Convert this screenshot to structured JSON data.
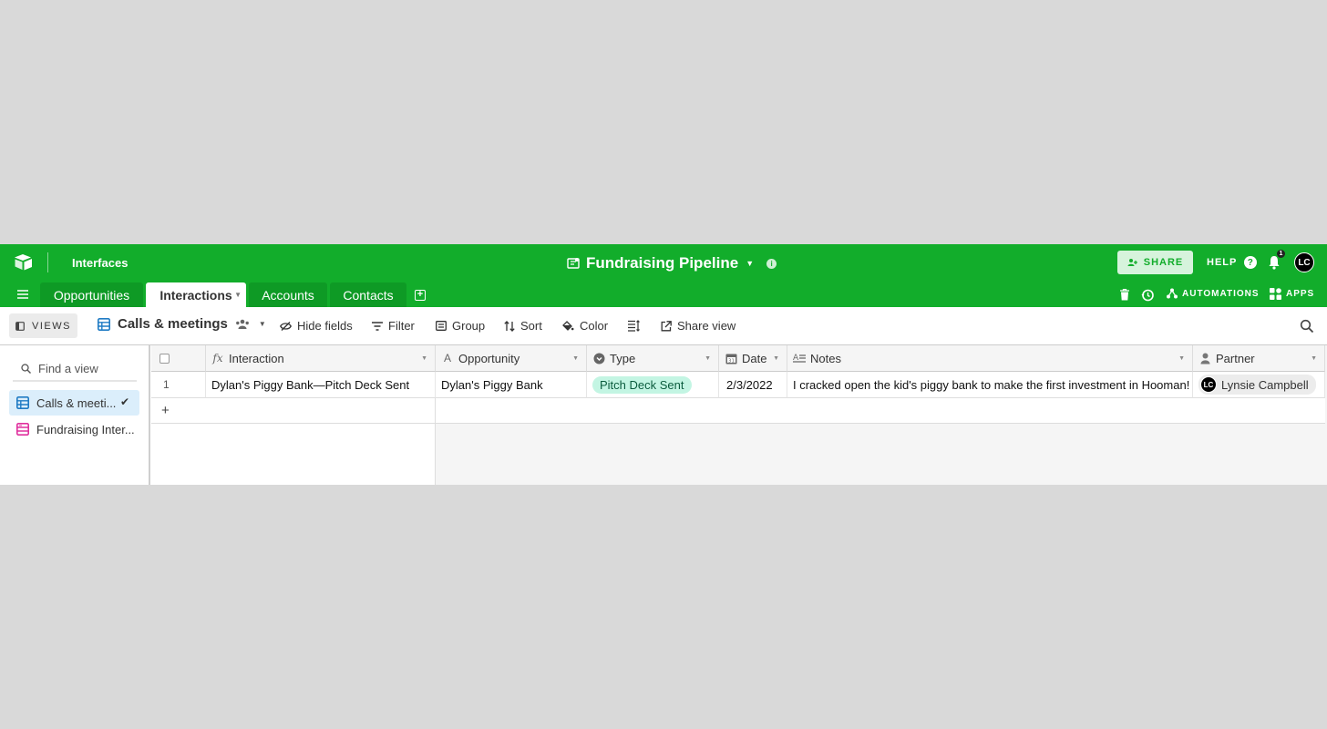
{
  "header": {
    "interfaces_label": "Interfaces",
    "base_name": "Fundraising Pipeline",
    "share_label": "SHARE",
    "help_label": "HELP",
    "notification_count": "1",
    "user_initials": "LC"
  },
  "tabs": [
    {
      "label": "Opportunities"
    },
    {
      "label": "Interactions"
    },
    {
      "label": "Accounts"
    },
    {
      "label": "Contacts"
    }
  ],
  "right_actions": {
    "automations_label": "AUTOMATIONS",
    "apps_label": "APPS"
  },
  "viewbar": {
    "views_label": "VIEWS",
    "current_view": "Calls & meetings",
    "hide_fields": "Hide fields",
    "filter": "Filter",
    "group": "Group",
    "sort": "Sort",
    "color": "Color",
    "share_view": "Share view"
  },
  "sidebar": {
    "find_placeholder": "Find a view",
    "views": [
      {
        "label": "Calls & meeti...",
        "icon": "grid-view-icon"
      },
      {
        "label": "Fundraising Inter...",
        "icon": "form-view-icon"
      }
    ]
  },
  "grid": {
    "columns": [
      "Interaction",
      "Opportunity",
      "Type",
      "Date",
      "Notes",
      "Partner"
    ],
    "rows": [
      {
        "row_number": "1",
        "interaction": "Dylan's Piggy Bank—Pitch Deck Sent",
        "opportunity": "Dylan's Piggy Bank",
        "type": "Pitch Deck Sent",
        "date": "2/3/2022",
        "notes": "I cracked open the kid's piggy bank to make the first investment in Hooman!",
        "partner_initials": "LC",
        "partner": "Lynsie Campbell"
      }
    ],
    "add_row_symbol": "+"
  },
  "colors": {
    "brand_green": "#12ad2b",
    "type_pill": "#c3f5e3",
    "active_view_bg": "#dbeefb"
  }
}
